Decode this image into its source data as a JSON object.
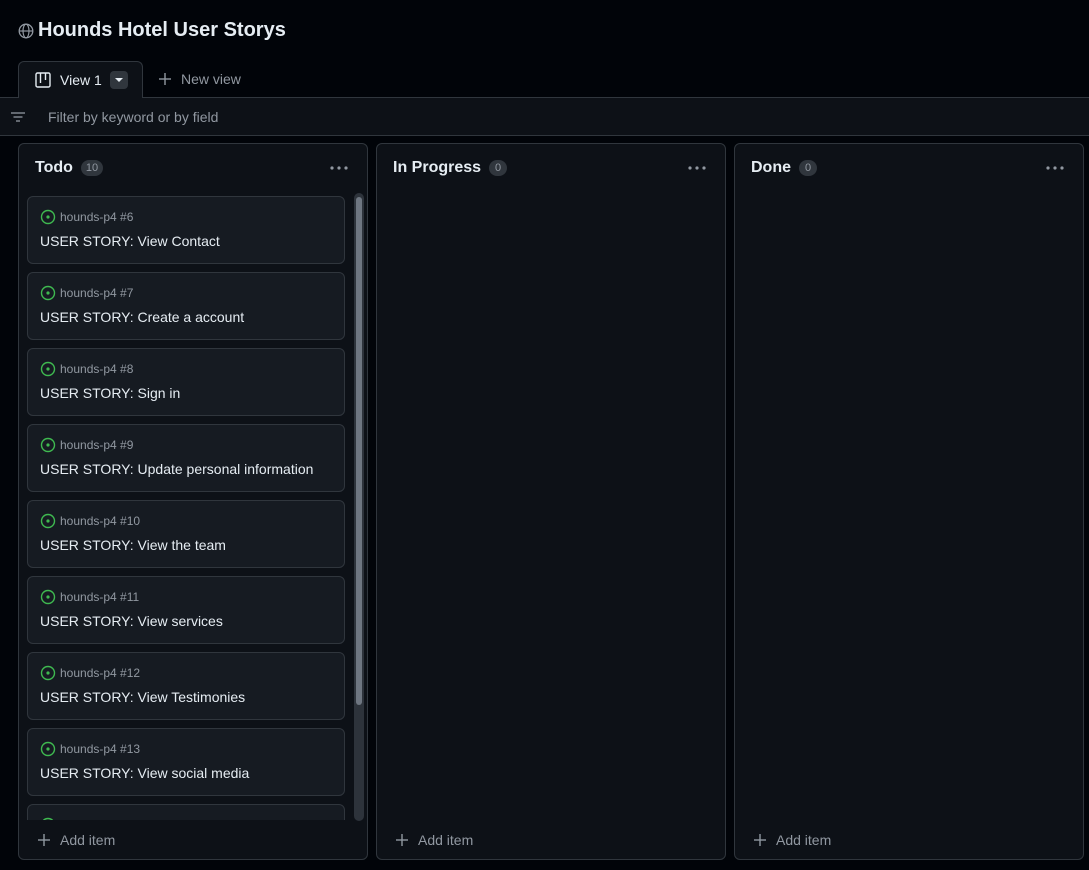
{
  "project": {
    "title": "Hounds Hotel User Storys"
  },
  "tabs": {
    "active_label": "View 1",
    "new_view_label": "New view"
  },
  "filter": {
    "placeholder": "Filter by keyword or by field"
  },
  "icons": {
    "globe": "globe-icon",
    "board": "board-icon",
    "caret": "caret-down-icon",
    "plus": "plus-icon",
    "filter": "filter-icon",
    "kebab": "kebab-horizontal-icon",
    "issue_open": "issue-opened-icon"
  },
  "colors": {
    "background": "#010409",
    "column_bg": "#0d1117",
    "card_bg": "#161b22",
    "border": "#30363d",
    "open_issue": "#3fb950"
  },
  "columns": [
    {
      "title": "Todo",
      "count": "10",
      "add_label": "Add item",
      "cards": [
        {
          "repo": "hounds-p4 #6",
          "title": "USER STORY: View Contact"
        },
        {
          "repo": "hounds-p4 #7",
          "title": "USER STORY: Create a account"
        },
        {
          "repo": "hounds-p4 #8",
          "title": "USER STORY: Sign in"
        },
        {
          "repo": "hounds-p4 #9",
          "title": "USER STORY: Update personal information"
        },
        {
          "repo": "hounds-p4 #10",
          "title": "USER STORY: View the team"
        },
        {
          "repo": "hounds-p4 #11",
          "title": "USER STORY: View services"
        },
        {
          "repo": "hounds-p4 #12",
          "title": "USER STORY: View Testimonies"
        },
        {
          "repo": "hounds-p4 #13",
          "title": "USER STORY: View social media"
        },
        {
          "repo": "",
          "title": ""
        }
      ]
    },
    {
      "title": "In Progress",
      "count": "0",
      "add_label": "Add item",
      "cards": []
    },
    {
      "title": "Done",
      "count": "0",
      "add_label": "Add item",
      "cards": []
    }
  ]
}
